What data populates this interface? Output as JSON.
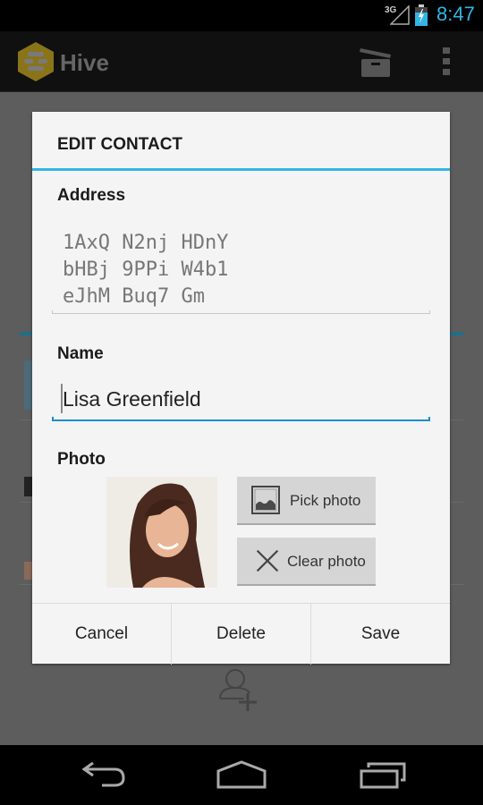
{
  "status_bar": {
    "network": "3G",
    "time": "8:47",
    "time_color": "#33b5e5"
  },
  "action_bar": {
    "app_name": "Hive",
    "icons": [
      "hive-logo-icon",
      "archive-icon",
      "overflow-menu-icon"
    ]
  },
  "dialog": {
    "title": "EDIT CONTACT",
    "accent_color": "#33b5e5",
    "address": {
      "label": "Address",
      "value": "1AxQ N2nj HDnY\nbHBj 9PPi W4b1\neJhM Buq7 Gm"
    },
    "name": {
      "label": "Name",
      "value": "Lisa Greenfield"
    },
    "photo": {
      "label": "Photo",
      "pick_label": "Pick photo",
      "clear_label": "Clear photo"
    },
    "buttons": {
      "cancel": "Cancel",
      "delete": "Delete",
      "save": "Save"
    }
  },
  "background": {
    "add_contact_icon": "add-contact-icon"
  },
  "nav_bar": {
    "icons": [
      "back-icon",
      "home-icon",
      "recent-apps-icon"
    ]
  }
}
